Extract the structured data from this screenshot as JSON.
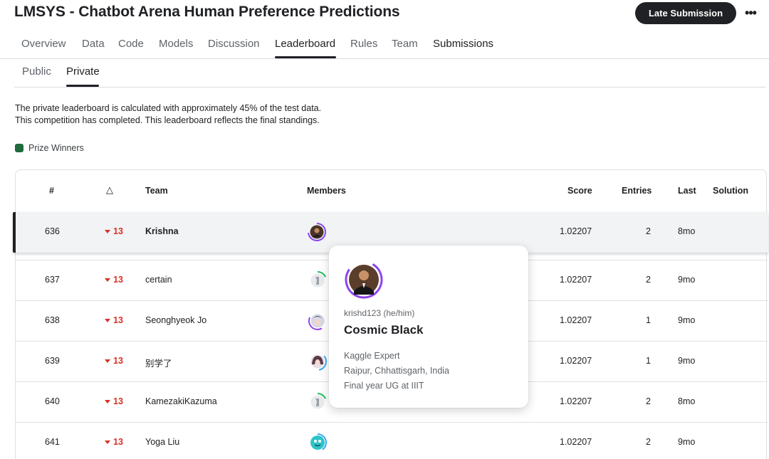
{
  "header": {
    "title": "LMSYS - Chatbot Arena Human Preference Predictions",
    "late_submission": "Late Submission",
    "more_icon": "more-horizontal-icon",
    "more_glyph": "•••"
  },
  "tabs": [
    {
      "label": "Overview"
    },
    {
      "label": "Data"
    },
    {
      "label": "Code"
    },
    {
      "label": "Models"
    },
    {
      "label": "Discussion"
    },
    {
      "label": "Leaderboard",
      "active": true
    },
    {
      "label": "Rules"
    },
    {
      "label": "Team"
    },
    {
      "label": "Submissions"
    }
  ],
  "subtabs": [
    {
      "label": "Public"
    },
    {
      "label": "Private",
      "active": true
    }
  ],
  "notes": {
    "line1": "The private leaderboard is calculated with approximately 45% of the test data.",
    "line2": "This competition has completed. This leaderboard reflects the final standings."
  },
  "prize": {
    "label": "Prize Winners",
    "color": "#1e6b3c"
  },
  "columns": {
    "rank": "#",
    "delta": "△",
    "team": "Team",
    "members": "Members",
    "score": "Score",
    "entries": "Entries",
    "last": "Last",
    "solution": "Solution"
  },
  "rows": [
    {
      "rank": "636",
      "delta": "13",
      "team": "Krishna",
      "score": "1.02207",
      "entries": "2",
      "last": "8mo",
      "avatar": "dark-portrait-avatar"
    },
    {
      "rank": "637",
      "delta": "13",
      "team": "certain",
      "score": "1.02207",
      "entries": "2",
      "last": "9mo",
      "avatar": "default-avatar"
    },
    {
      "rank": "638",
      "delta": "13",
      "team": "Seonghyeok Jo",
      "score": "1.02207",
      "entries": "1",
      "last": "9mo",
      "avatar": "anime-avatar"
    },
    {
      "rank": "639",
      "delta": "13",
      "team": "别学了",
      "score": "1.02207",
      "entries": "1",
      "last": "9mo",
      "avatar": "anime-girl-avatar"
    },
    {
      "rank": "640",
      "delta": "13",
      "team": "KamezakiKazuma",
      "score": "1.02207",
      "entries": "2",
      "last": "8mo",
      "avatar": "default-avatar"
    },
    {
      "rank": "641",
      "delta": "13",
      "team": "Yoga Liu",
      "score": "1.02207",
      "entries": "2",
      "last": "9mo",
      "avatar": "teal-cartoon-avatar"
    }
  ],
  "popover": {
    "handle": "krishd123 (he/him)",
    "name": "Cosmic Black",
    "tier": "Kaggle Expert",
    "location": "Raipur, Chhattisgarh, India",
    "occupation": "Final year UG at IIIT",
    "ring_color": "#8e44ec"
  },
  "colors": {
    "decline": "#d93025",
    "ring_green": "#20c05c",
    "ring_purple": "#8e44ec",
    "ring_blue": "#3ba7f5"
  }
}
